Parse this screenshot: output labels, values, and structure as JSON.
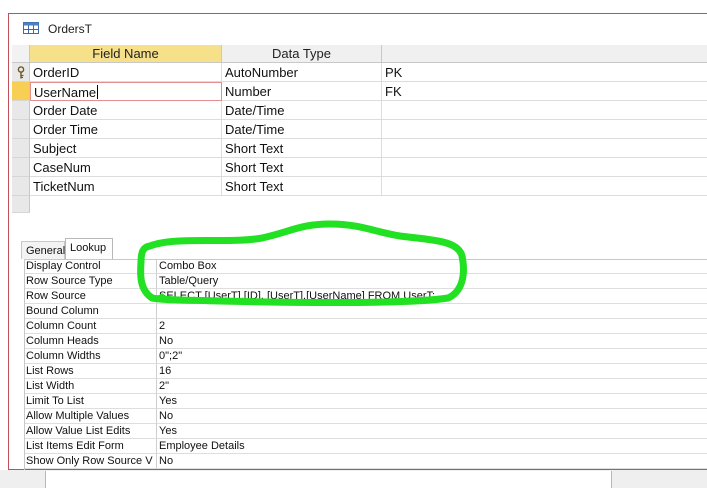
{
  "tab": {
    "title": "OrdersT",
    "icon": "table-icon"
  },
  "columns": {
    "field_name": "Field Name",
    "data_type": "Data Type",
    "description": ""
  },
  "fields": [
    {
      "name": "OrderID",
      "type": "AutoNumber",
      "desc": "PK",
      "primary_key": true
    },
    {
      "name": "UserName",
      "type": "Number",
      "desc": "FK",
      "selected": true
    },
    {
      "name": "Order Date",
      "type": "Date/Time",
      "desc": ""
    },
    {
      "name": "Order Time",
      "type": "Date/Time",
      "desc": ""
    },
    {
      "name": "Subject",
      "type": "Short Text",
      "desc": ""
    },
    {
      "name": "CaseNum",
      "type": "Short Text",
      "desc": ""
    },
    {
      "name": "TicketNum",
      "type": "Short Text",
      "desc": ""
    }
  ],
  "property_tabs": {
    "general": "General",
    "lookup": "Lookup",
    "active": "lookup"
  },
  "lookup_properties": [
    {
      "label": "Display Control",
      "value": "Combo Box"
    },
    {
      "label": "Row Source Type",
      "value": "Table/Query"
    },
    {
      "label": "Row Source",
      "value": "SELECT [UserT].[ID], [UserT].[UserName] FROM UserT;"
    },
    {
      "label": "Bound Column",
      "value": ""
    },
    {
      "label": "Column Count",
      "value": "2"
    },
    {
      "label": "Column Heads",
      "value": "No"
    },
    {
      "label": "Column Widths",
      "value": "0\";2\""
    },
    {
      "label": "List Rows",
      "value": "16"
    },
    {
      "label": "List Width",
      "value": "2\""
    },
    {
      "label": "Limit To List",
      "value": "Yes"
    },
    {
      "label": "Allow Multiple Values",
      "value": "No"
    },
    {
      "label": "Allow Value List Edits",
      "value": "Yes"
    },
    {
      "label": "List Items Edit Form",
      "value": "Employee Details"
    },
    {
      "label": "Show Only Row Source V",
      "value": "No"
    }
  ],
  "colors": {
    "header_selected": "#f7e08a",
    "row_selector_active": "#f7cf55",
    "annotation": "#22e022",
    "window_border": "#c0505a"
  }
}
